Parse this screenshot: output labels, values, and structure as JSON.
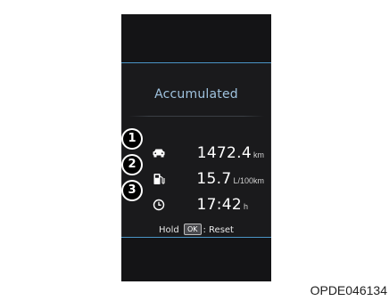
{
  "display": {
    "title": "Accumulated",
    "rows": [
      {
        "marker": "1",
        "icon": "car-icon",
        "value": "1472.4",
        "unit": "km"
      },
      {
        "marker": "2",
        "icon": "fuel-pump-icon",
        "value": "15.7",
        "unit": "L/100km"
      },
      {
        "marker": "3",
        "icon": "clock-icon",
        "value": "17:42",
        "unit": "h"
      }
    ],
    "hint": {
      "prefix": "Hold",
      "key": "OK",
      "suffix": ": Reset"
    },
    "accent_color": "#4b95c6"
  },
  "caption": "OPDE046134"
}
